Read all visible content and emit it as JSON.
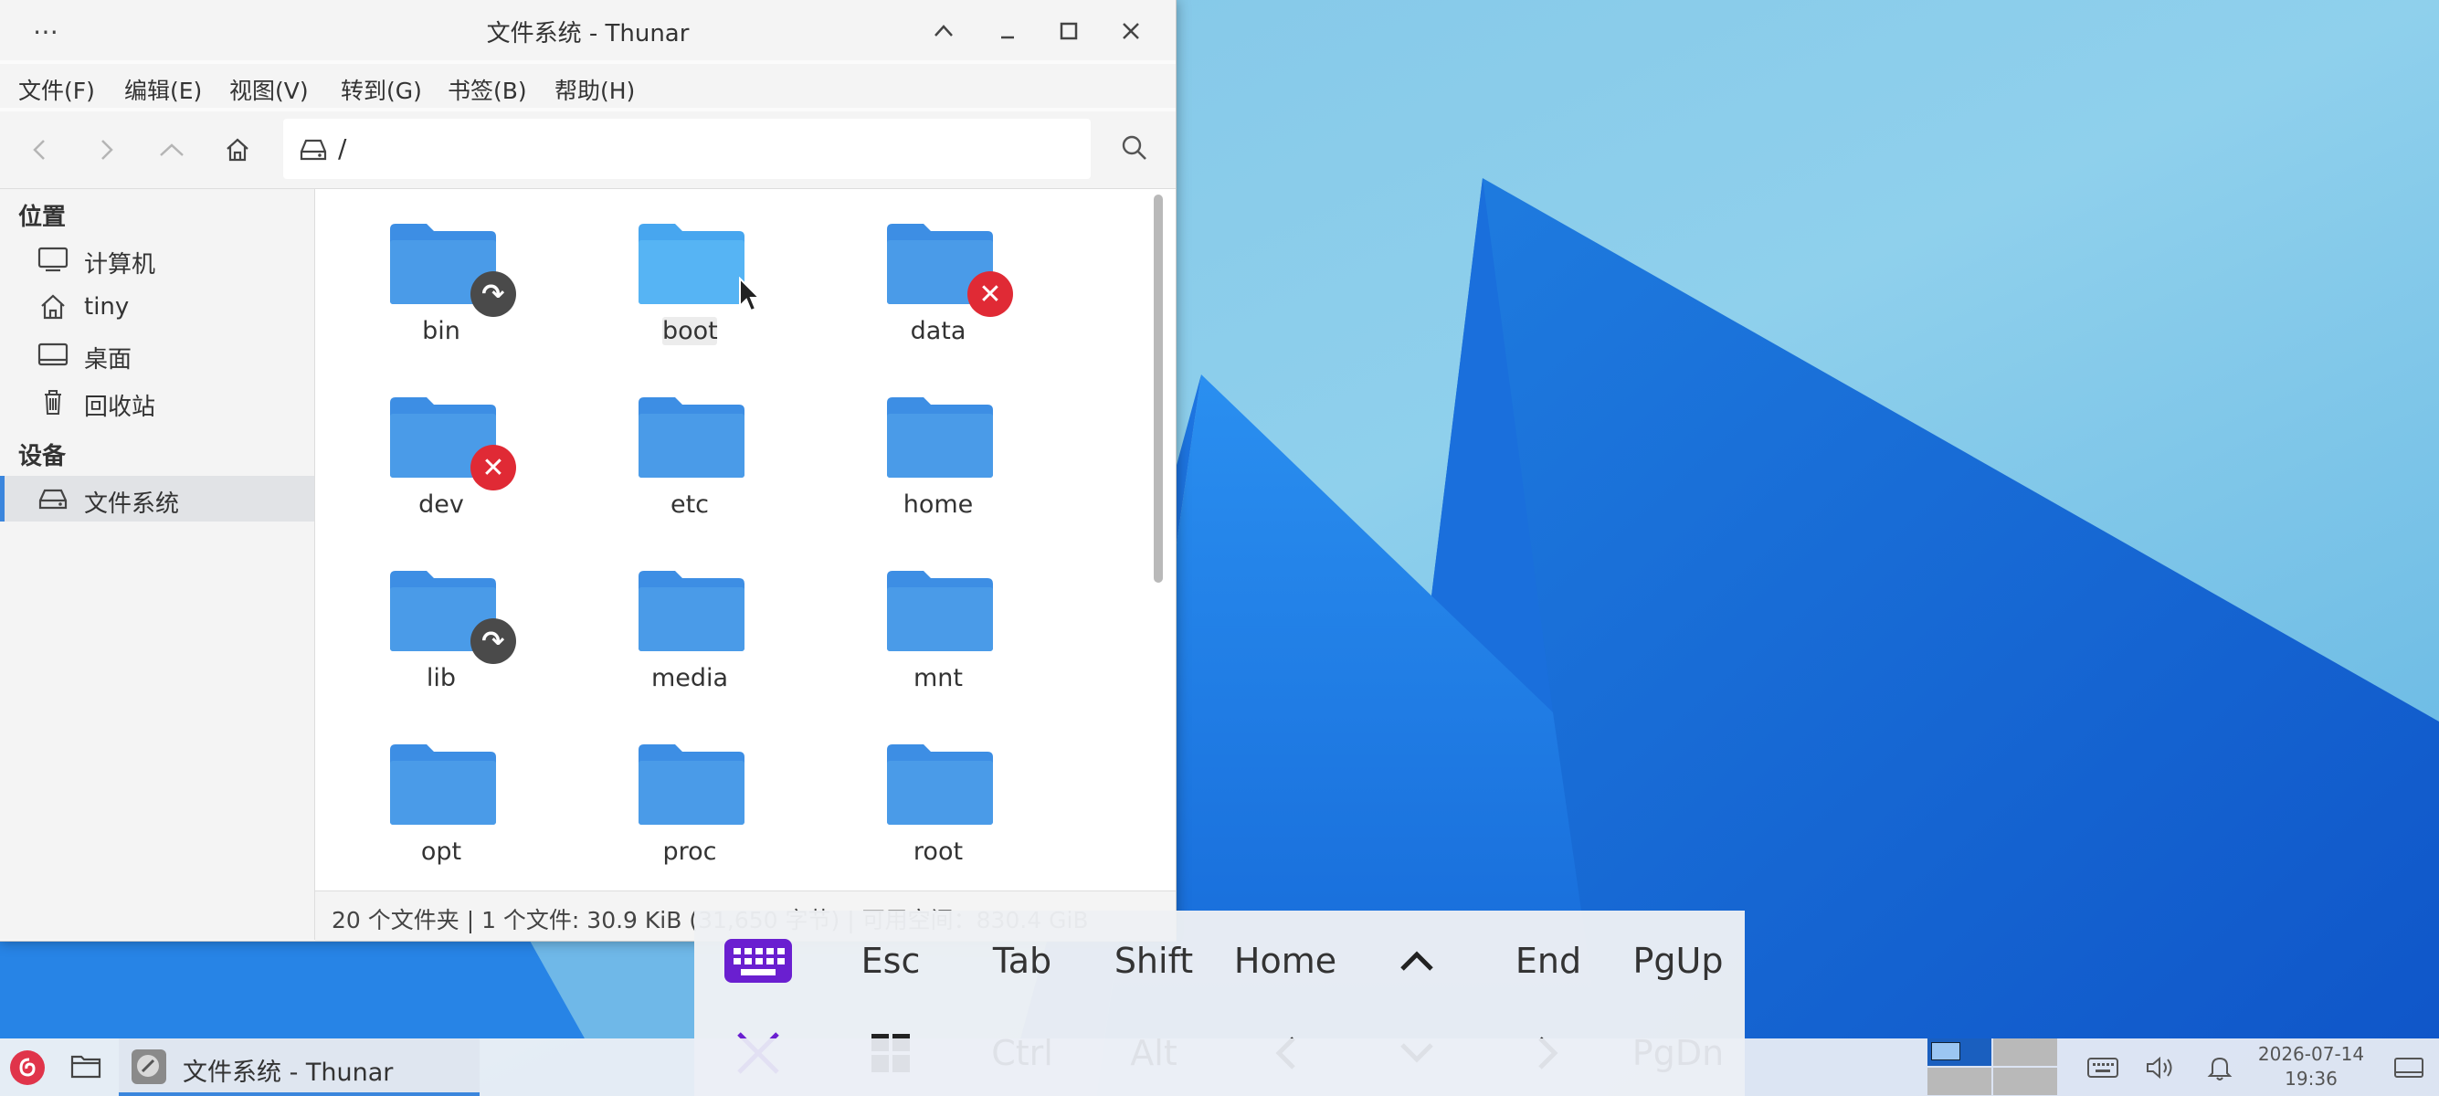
{
  "window": {
    "title": "文件系统 - Thunar"
  },
  "menubar": {
    "items": [
      "文件(F)",
      "编辑(E)",
      "视图(V)",
      "转到(G)",
      "书签(B)",
      "帮助(H)"
    ]
  },
  "location": {
    "path": "/"
  },
  "sidebar": {
    "places_header": "位置",
    "devices_header": "设备",
    "places": [
      {
        "label": "计算机",
        "icon": "computer-icon"
      },
      {
        "label": "tiny",
        "icon": "home-icon"
      },
      {
        "label": "桌面",
        "icon": "desktop-icon"
      },
      {
        "label": "回收站",
        "icon": "trash-icon"
      }
    ],
    "devices": [
      {
        "label": "文件系统",
        "icon": "drive-icon",
        "active": true
      }
    ]
  },
  "files": [
    {
      "name": "bin",
      "badge": "link"
    },
    {
      "name": "boot",
      "badge": "",
      "hover": true
    },
    {
      "name": "data",
      "badge": "error"
    },
    {
      "name": "dev",
      "badge": "error"
    },
    {
      "name": "etc",
      "badge": ""
    },
    {
      "name": "home",
      "badge": ""
    },
    {
      "name": "lib",
      "badge": "link"
    },
    {
      "name": "media",
      "badge": ""
    },
    {
      "name": "mnt",
      "badge": ""
    },
    {
      "name": "opt",
      "badge": ""
    },
    {
      "name": "proc",
      "badge": ""
    },
    {
      "name": "root",
      "badge": ""
    }
  ],
  "status": {
    "text": "20 个文件夹 | 1 个文件: 30.9 KiB (31,650 字节) | 可用空间：830.4 GiB"
  },
  "keyboard": {
    "row1": [
      "Esc",
      "Tab",
      "Shift",
      "Home",
      "End",
      "PgUp"
    ],
    "row2": [
      "Ctrl",
      "Alt",
      "PgDn"
    ]
  },
  "taskbar": {
    "window_label": "文件系统 - Thunar",
    "date": "2026-07-14",
    "time": "19:36"
  },
  "colors": {
    "accent": "#3b86dd",
    "folder": "#4a9be8",
    "osk_purple": "#6a1fd0"
  }
}
